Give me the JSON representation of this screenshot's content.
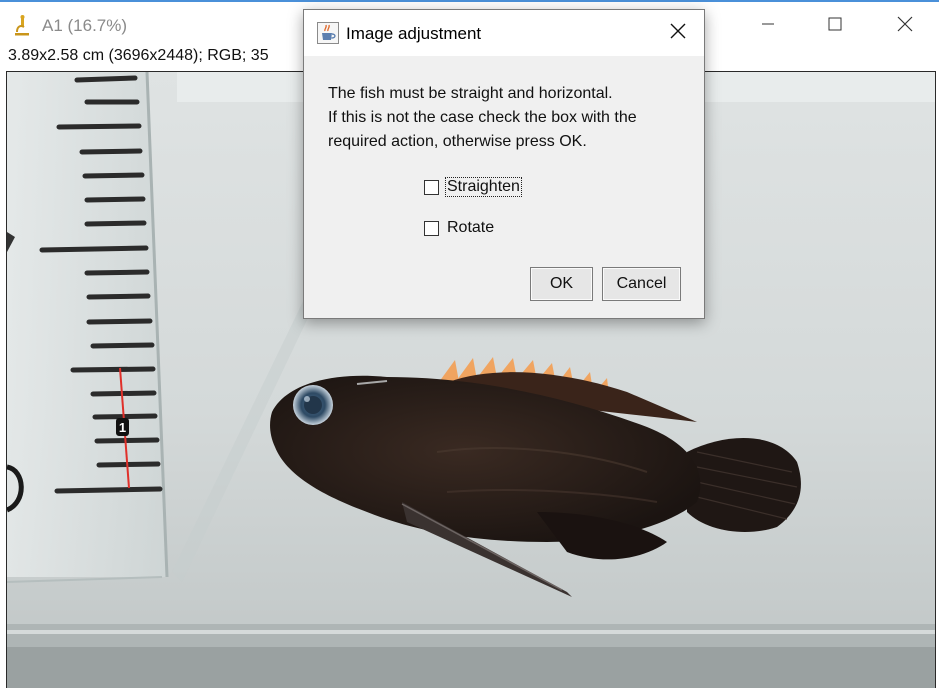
{
  "window": {
    "title": "A1 (16.7%)",
    "icon": "microscope-icon",
    "controls": [
      "minimize-icon",
      "maximize-icon",
      "close-icon"
    ]
  },
  "image_info": "3.89x2.58 cm (3696x2448); RGB; 35",
  "scale_marker": "1",
  "dialog": {
    "title": "Image adjustment",
    "icon": "java-cup-icon",
    "message_lines": [
      "The fish must be straight and horizontal.",
      "If this is not the case check the box with the",
      "required action, otherwise press OK."
    ],
    "options": [
      {
        "label": "Straighten",
        "checked": false,
        "focused": true
      },
      {
        "label": "Rotate",
        "checked": false,
        "focused": false
      }
    ],
    "ok_label": "OK",
    "cancel_label": "Cancel"
  },
  "colors": {
    "title_inactive": "#8a8a8a",
    "dialog_bg": "#f0f0f0",
    "measure_line": "#e0302a",
    "window_accent": "#4a90d9"
  }
}
